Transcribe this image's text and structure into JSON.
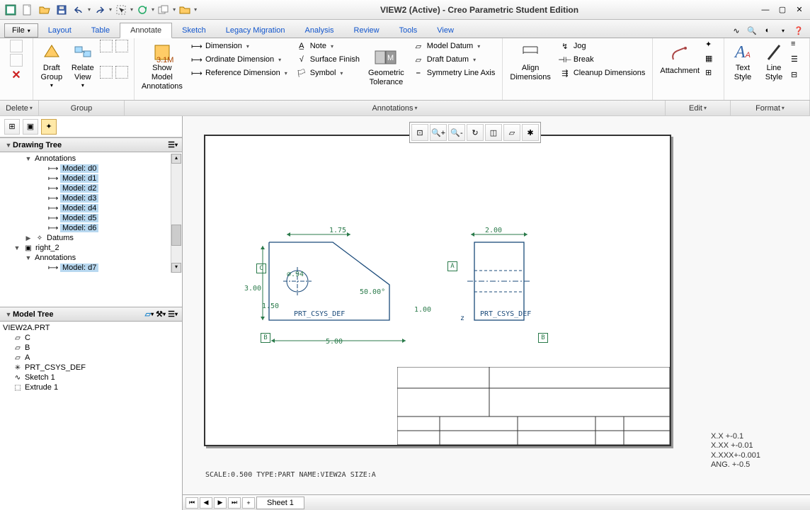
{
  "title": "VIEW2 (Active) - Creo Parametric Student Edition",
  "menutabs": {
    "file": "File",
    "layout": "Layout",
    "table": "Table",
    "annotate": "Annotate",
    "sketch": "Sketch",
    "legacy": "Legacy Migration",
    "analysis": "Analysis",
    "review": "Review",
    "tools": "Tools",
    "view": "View"
  },
  "ribbon": {
    "delete": "Delete",
    "group": "Group",
    "draft_group": "Draft\nGroup",
    "relate_view": "Relate\nView",
    "show_model": "Show Model\nAnnotations",
    "dimension": "Dimension",
    "ordinate": "Ordinate Dimension",
    "reference": "Reference Dimension",
    "note": "Note",
    "surface_finish": "Surface Finish",
    "symbol": "Symbol",
    "geom_tol": "Geometric\nTolerance",
    "model_datum": "Model Datum",
    "draft_datum": "Draft Datum",
    "sym_line": "Symmetry Line Axis",
    "align_dim": "Align\nDimensions",
    "jog": "Jog",
    "break": "Break",
    "cleanup": "Cleanup Dimensions",
    "attachment": "Attachment",
    "text_style": "Text\nStyle",
    "line_style": "Line\nStyle",
    "titles": {
      "delete": "Delete",
      "group": "Group",
      "annotations": "Annotations",
      "edit": "Edit",
      "format": "Format"
    }
  },
  "tree": {
    "drawing_tree": "Drawing Tree",
    "annotations": "Annotations",
    "models": [
      "Model: d0",
      "Model: d1",
      "Model: d2",
      "Model: d3",
      "Model: d4",
      "Model: d5",
      "Model: d6"
    ],
    "datums": "Datums",
    "right2": "right_2",
    "annotations2": "Annotations",
    "model_d7": "Model: d7",
    "model_tree": "Model Tree",
    "part": "VIEW2A.PRT",
    "items": [
      "C",
      "B",
      "A",
      "PRT_CSYS_DEF",
      "Sketch 1",
      "Extrude 1"
    ]
  },
  "drawing": {
    "dims": {
      "d175": "1.75",
      "d200": "2.00",
      "d300": "3.00",
      "d150": "1.50",
      "d500": "5.00",
      "d100": "1.00",
      "dia": "⌀.94",
      "ang": "50.00°"
    },
    "csys": "PRT_CSYS_DEF",
    "datums": {
      "a": "A",
      "b": "B",
      "c": "C"
    },
    "notes": [
      "X.X    +-0.1",
      "X.XX   +-0.01",
      "X.XXX+-0.001",
      "ANG. +-0.5"
    ],
    "status": "SCALE:0.500  TYPE:PART  NAME:VIEW2A  SIZE:A"
  },
  "sheet": {
    "label": "Sheet 1"
  }
}
